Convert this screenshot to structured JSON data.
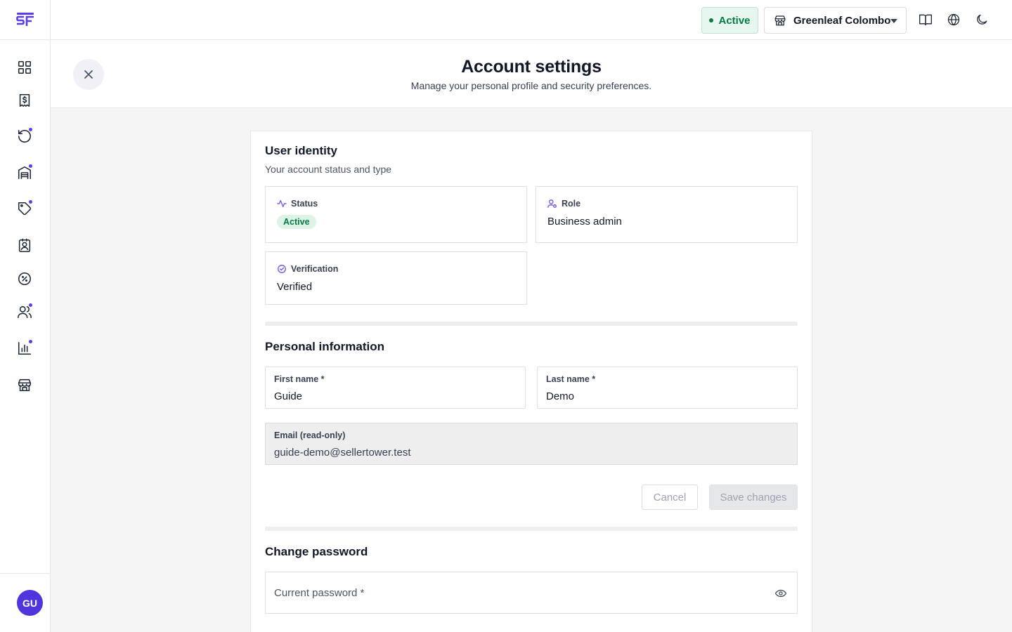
{
  "sidebar": {
    "logo": "SF",
    "items": [
      {
        "name": "dashboard",
        "icon": "grid-icon",
        "dot": false
      },
      {
        "name": "sales",
        "icon": "receipt-dollar-icon",
        "dot": false
      },
      {
        "name": "returns",
        "icon": "rotate-ccw-icon",
        "dot": true
      },
      {
        "name": "inventory",
        "icon": "warehouse-icon",
        "dot": true
      },
      {
        "name": "products",
        "icon": "tag-icon",
        "dot": true
      },
      {
        "name": "contacts",
        "icon": "contact-book-icon",
        "dot": false
      },
      {
        "name": "discounts",
        "icon": "percent-badge-icon",
        "dot": false
      },
      {
        "name": "customers",
        "icon": "users-icon",
        "dot": true
      },
      {
        "name": "reports",
        "icon": "bar-chart-icon",
        "dot": true
      },
      {
        "name": "stores",
        "icon": "store-icon",
        "dot": false
      }
    ],
    "avatar_initials": "GU"
  },
  "topbar": {
    "status_label": "Active",
    "store_name": "Greenleaf Colombo",
    "icons": [
      "book-icon",
      "globe-icon",
      "moon-icon"
    ]
  },
  "header": {
    "title": "Account settings",
    "subtitle": "Manage your personal profile and security preferences."
  },
  "identity": {
    "title": "User identity",
    "subtitle": "Your account status and type",
    "status_label": "Status",
    "status_value": "Active",
    "role_label": "Role",
    "role_value": "Business admin",
    "verification_label": "Verification",
    "verification_value": "Verified"
  },
  "personal": {
    "title": "Personal information",
    "first_name_label": "First name *",
    "first_name_value": "Guide",
    "last_name_label": "Last name *",
    "last_name_value": "Demo",
    "email_label": "Email (read-only)",
    "email_value": "guide-demo@sellertower.test",
    "cancel_label": "Cancel",
    "save_label": "Save changes"
  },
  "password": {
    "title": "Change password",
    "current_placeholder": "Current password *"
  },
  "colors": {
    "accent": "#5b3ee8",
    "success": "#047a47",
    "success_bg": "#e7f6ee"
  }
}
